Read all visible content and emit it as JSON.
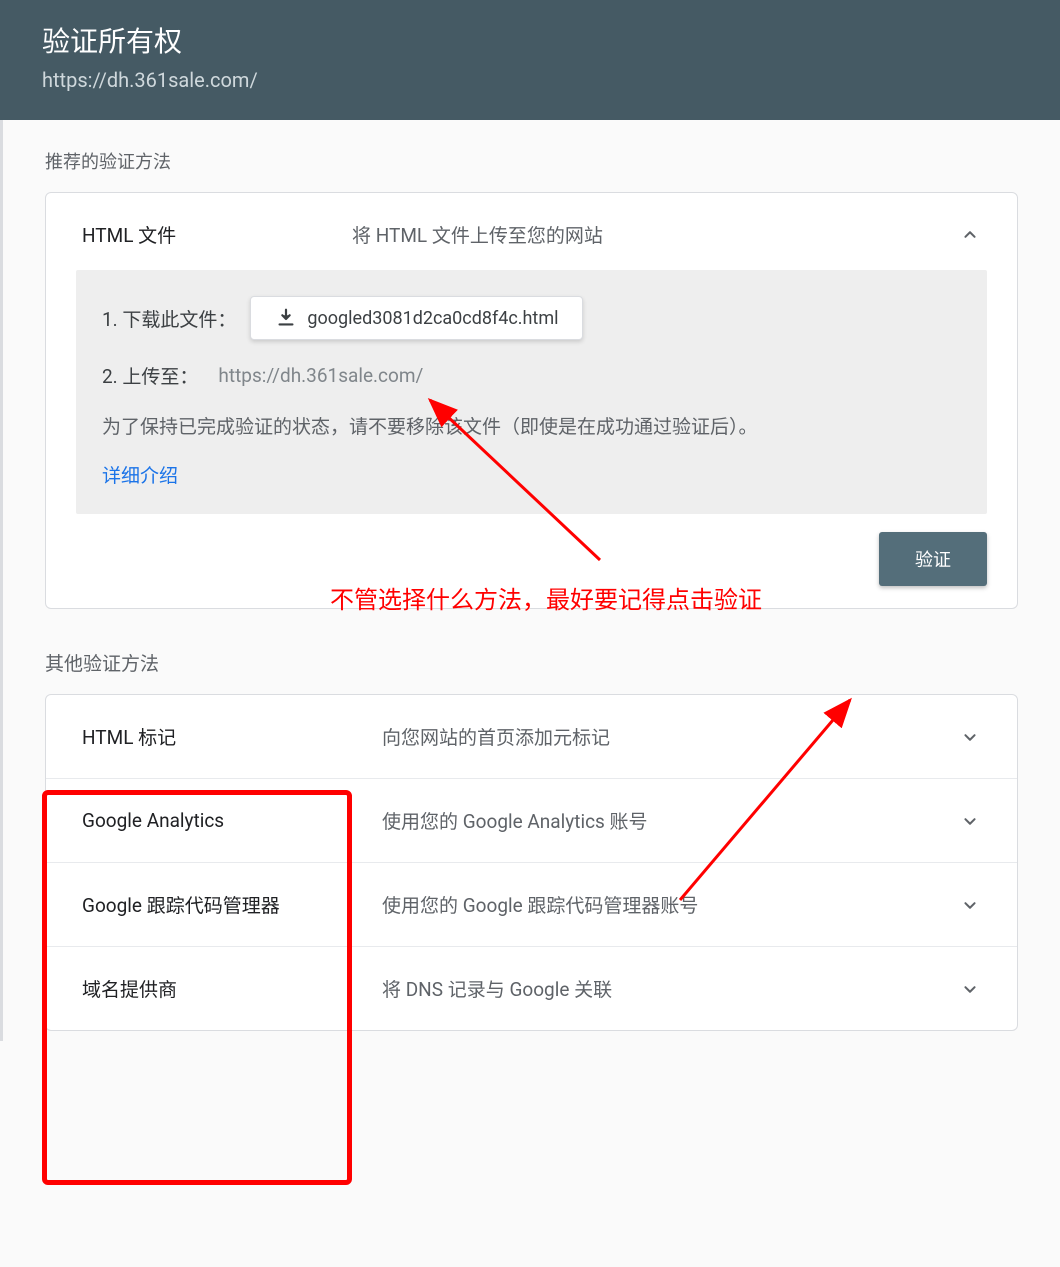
{
  "header": {
    "title": "验证所有权",
    "url": "https://dh.361sale.com/"
  },
  "recommended": {
    "section_label": "推荐的验证方法",
    "method_name": "HTML 文件",
    "method_desc": "将 HTML 文件上传至您的网站",
    "step1_label": "1. 下载此文件：",
    "download_filename": "googled3081d2ca0cd8f4c.html",
    "step2_label": "2. 上传至：",
    "upload_url": "https://dh.361sale.com/",
    "note": "为了保持已完成验证的状态，请不要移除该文件（即使是在成功通过验证后）。",
    "learn_more": "详细介绍",
    "verify_label": "验证"
  },
  "other": {
    "section_label": "其他验证方法",
    "items": [
      {
        "name": "HTML 标记",
        "desc": "向您网站的首页添加元标记"
      },
      {
        "name": "Google Analytics",
        "desc": "使用您的 Google Analytics 账号"
      },
      {
        "name": "Google 跟踪代码管理器",
        "desc": "使用您的 Google 跟踪代码管理器账号"
      },
      {
        "name": "域名提供商",
        "desc": "将 DNS 记录与 Google 关联"
      }
    ]
  },
  "annotations": {
    "line1": "不管选择什么方法，最好要记得点击验证"
  }
}
